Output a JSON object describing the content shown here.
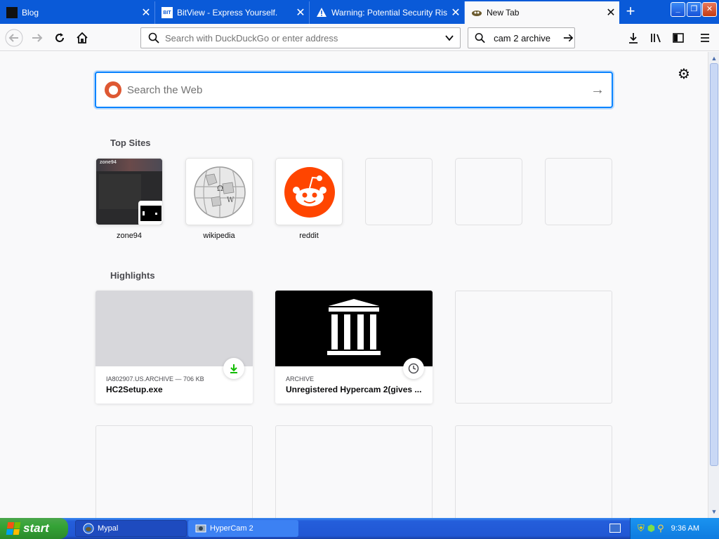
{
  "tabs": [
    {
      "title": "Blog",
      "active": false,
      "close": "✕"
    },
    {
      "title": "BitView - Express Yourself.",
      "active": false,
      "close": "✕"
    },
    {
      "title": "Warning: Potential Security Risk Ahead",
      "active": false,
      "close": "✕"
    },
    {
      "title": "New Tab",
      "active": true,
      "close": "✕"
    }
  ],
  "new_tab_label": "+",
  "toolbar": {
    "url_placeholder": "Search with DuckDuckGo or enter address",
    "search_value": "cam 2 archive"
  },
  "content": {
    "web_search_placeholder": "Search the Web",
    "top_sites_title": "Top Sites",
    "top_sites": [
      {
        "label": "zone94"
      },
      {
        "label": "wikipedia"
      },
      {
        "label": "reddit"
      },
      {
        "label": ""
      },
      {
        "label": ""
      },
      {
        "label": ""
      }
    ],
    "zone94_logo_text": "zone94",
    "highlights_title": "Highlights",
    "highlights": [
      {
        "meta": "IA802907.US.ARCHIVE — 706 KB",
        "title": "HC2Setup.exe",
        "badge": "download-icon"
      },
      {
        "meta": "ARCHIVE",
        "title": "Unregistered Hypercam 2(gives ...",
        "badge": "clock-icon"
      }
    ]
  },
  "taskbar": {
    "start_label": "start",
    "items": [
      {
        "label": "Mypal"
      },
      {
        "label": "HyperCam 2"
      }
    ],
    "clock": "9:36 AM"
  },
  "colors": {
    "accent": "#0a84ff",
    "tabbar": "#0a5ad8",
    "reddit": "#ff4500",
    "download": "#12bc00"
  }
}
